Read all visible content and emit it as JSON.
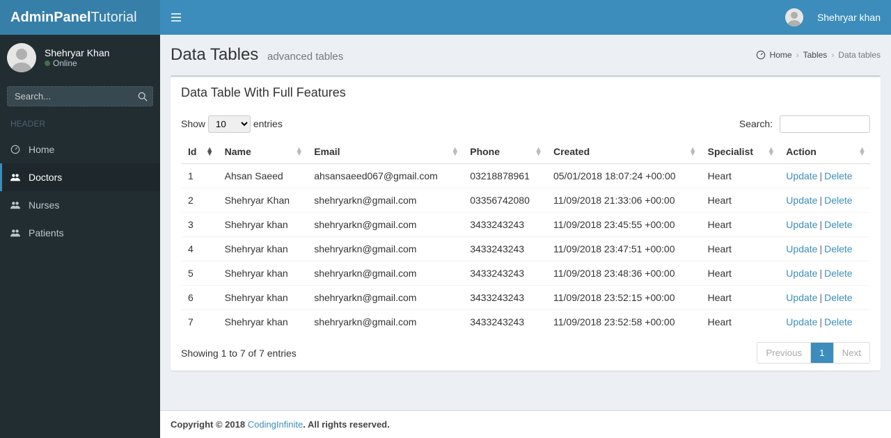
{
  "brand": {
    "bold": "AdminPanel",
    "light": "Tutorial"
  },
  "user": {
    "name": "Shehryar Khan",
    "status": "Online"
  },
  "topbar_user": "Shehryar khan",
  "search": {
    "placeholder": "Search..."
  },
  "sidebar": {
    "section": "HEADER",
    "items": [
      {
        "label": "Home"
      },
      {
        "label": "Doctors"
      },
      {
        "label": "Nurses"
      },
      {
        "label": "Patients"
      }
    ]
  },
  "page": {
    "title": "Data Tables",
    "subtitle": "advanced tables",
    "breadcrumb": {
      "home": "Home",
      "l1": "Tables",
      "l2": "Data tables"
    }
  },
  "panel": {
    "title": "Data Table With Full Features"
  },
  "dt": {
    "show_label_pre": "Show",
    "show_value": "10",
    "show_label_post": "entries",
    "search_label": "Search:",
    "info": "Showing 1 to 7 of 7 entries",
    "prev": "Previous",
    "page": "1",
    "next": "Next",
    "update": "Update",
    "delete": "Delete"
  },
  "columns": [
    "Id",
    "Name",
    "Email",
    "Phone",
    "Created",
    "Specialist",
    "Action"
  ],
  "rows": [
    {
      "id": "1",
      "name": "Ahsan Saeed",
      "email": "ahsansaeed067@gmail.com",
      "phone": "03218878961",
      "created": "05/01/2018 18:07:24 +00:00",
      "specialist": "Heart"
    },
    {
      "id": "2",
      "name": "Shehryar Khan",
      "email": "shehryarkn@gmail.com",
      "phone": "03356742080",
      "created": "11/09/2018 21:33:06 +00:00",
      "specialist": "Heart"
    },
    {
      "id": "3",
      "name": "Shehryar khan",
      "email": "shehryarkn@gmail.com",
      "phone": "3433243243",
      "created": "11/09/2018 23:45:55 +00:00",
      "specialist": "Heart"
    },
    {
      "id": "4",
      "name": "Shehryar khan",
      "email": "shehryarkn@gmail.com",
      "phone": "3433243243",
      "created": "11/09/2018 23:47:51 +00:00",
      "specialist": "Heart"
    },
    {
      "id": "5",
      "name": "Shehryar khan",
      "email": "shehryarkn@gmail.com",
      "phone": "3433243243",
      "created": "11/09/2018 23:48:36 +00:00",
      "specialist": "Heart"
    },
    {
      "id": "6",
      "name": "Shehryar khan",
      "email": "shehryarkn@gmail.com",
      "phone": "3433243243",
      "created": "11/09/2018 23:52:15 +00:00",
      "specialist": "Heart"
    },
    {
      "id": "7",
      "name": "Shehryar khan",
      "email": "shehryarkn@gmail.com",
      "phone": "3433243243",
      "created": "11/09/2018 23:52:58 +00:00",
      "specialist": "Heart"
    }
  ],
  "footer": {
    "copyright": "Copyright © 2018 ",
    "link": "CodingInfinite",
    "rest": ". All rights reserved."
  }
}
